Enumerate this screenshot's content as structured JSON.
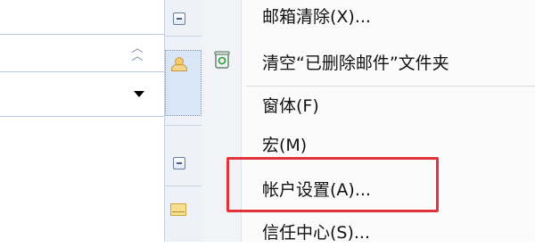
{
  "menu": {
    "items": [
      {
        "label": "邮箱清除(X)..."
      },
      {
        "label": "清空“已删除邮件”文件夹"
      },
      {
        "label": "窗体(F)"
      },
      {
        "label": "宏(M)"
      },
      {
        "label": "帐户设置(A)..."
      },
      {
        "label": "信任中心(S)..."
      }
    ]
  },
  "icons": {
    "chevron": "double-chevron-up-icon",
    "dropdown": "dropdown-arrow-icon",
    "recycle": "recycle-bin-icon",
    "group_toggle": "minus-icon",
    "contact": "contact-icon",
    "mail": "mail-icon"
  },
  "colors": {
    "highlight": "#e0343a",
    "selection": "#d9e6f7",
    "menu_background": "#fbfbfc"
  }
}
